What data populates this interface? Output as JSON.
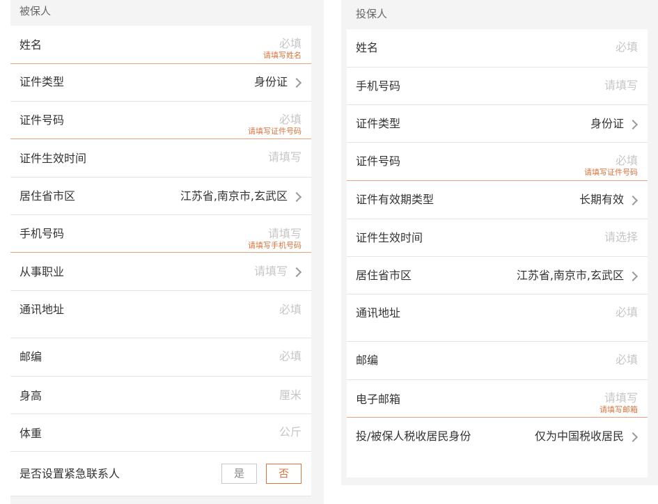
{
  "insured": {
    "title": "被保人",
    "rows": [
      {
        "label": "姓名",
        "value": "必填",
        "error": "请填写姓名"
      },
      {
        "label": "证件类型",
        "value": "身份证"
      },
      {
        "label": "证件号码",
        "value": "必填",
        "error": "请填写证件号码"
      },
      {
        "label": "证件生效时间",
        "value": "请填写"
      },
      {
        "label": "居住省市区",
        "value": "江苏省,南京市,玄武区"
      },
      {
        "label": "手机号码",
        "value": "请填写",
        "error": "请填写手机号码"
      },
      {
        "label": "从事职业",
        "value": "请填写"
      },
      {
        "label": "通讯地址",
        "value": "必填"
      },
      {
        "label": "邮编",
        "value": "必填"
      },
      {
        "label": "身高",
        "value": "厘米"
      },
      {
        "label": "体重",
        "value": "公斤"
      },
      {
        "label": "是否设置紧急联系人",
        "yes": "是",
        "no": "否"
      }
    ]
  },
  "policyholder": {
    "title": "投保人",
    "rows": [
      {
        "label": "姓名",
        "value": "必填"
      },
      {
        "label": "手机号码",
        "value": "请填写"
      },
      {
        "label": "证件类型",
        "value": "身份证"
      },
      {
        "label": "证件号码",
        "value": "必填",
        "error": "请填写证件号码"
      },
      {
        "label": "证件有效期类型",
        "value": "长期有效"
      },
      {
        "label": "证件生效时间",
        "value": "请选择"
      },
      {
        "label": "居住省市区",
        "value": "江苏省,南京市,玄武区"
      },
      {
        "label": "通讯地址",
        "value": "必填"
      },
      {
        "label": "邮编",
        "value": "必填"
      },
      {
        "label": "电子邮箱",
        "value": "请填写",
        "error": "请填写邮箱"
      },
      {
        "label": "投/被保人税收居民身份",
        "value": "仅为中国税收居民"
      }
    ]
  },
  "colors": {
    "error": "#d9743c",
    "placeholder": "#c6c6c6",
    "text": "#333333",
    "background": "#f4f4f4"
  }
}
